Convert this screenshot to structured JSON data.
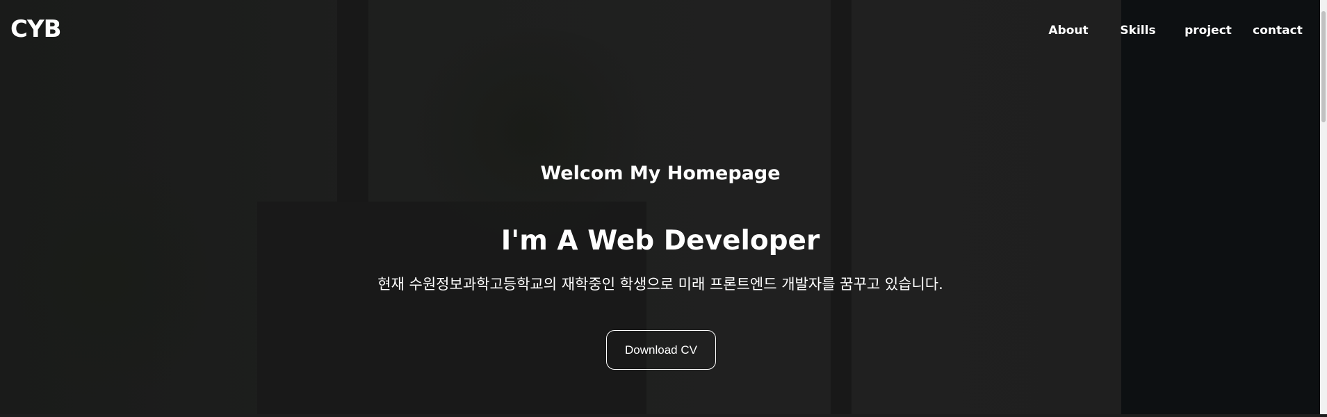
{
  "header": {
    "logo": "CYB",
    "nav": [
      {
        "label": "About"
      },
      {
        "label": "Skills"
      },
      {
        "label": "project"
      },
      {
        "label": "contact"
      }
    ]
  },
  "hero": {
    "welcome": "Welcom My Homepage",
    "title": "I'm A Web Developer",
    "description": "현재 수원정보과학고등학교의 재학중인 학생으로 미래 프론트엔드 개발자를 꿈꾸고 있습니다.",
    "button_label": "Download CV"
  }
}
